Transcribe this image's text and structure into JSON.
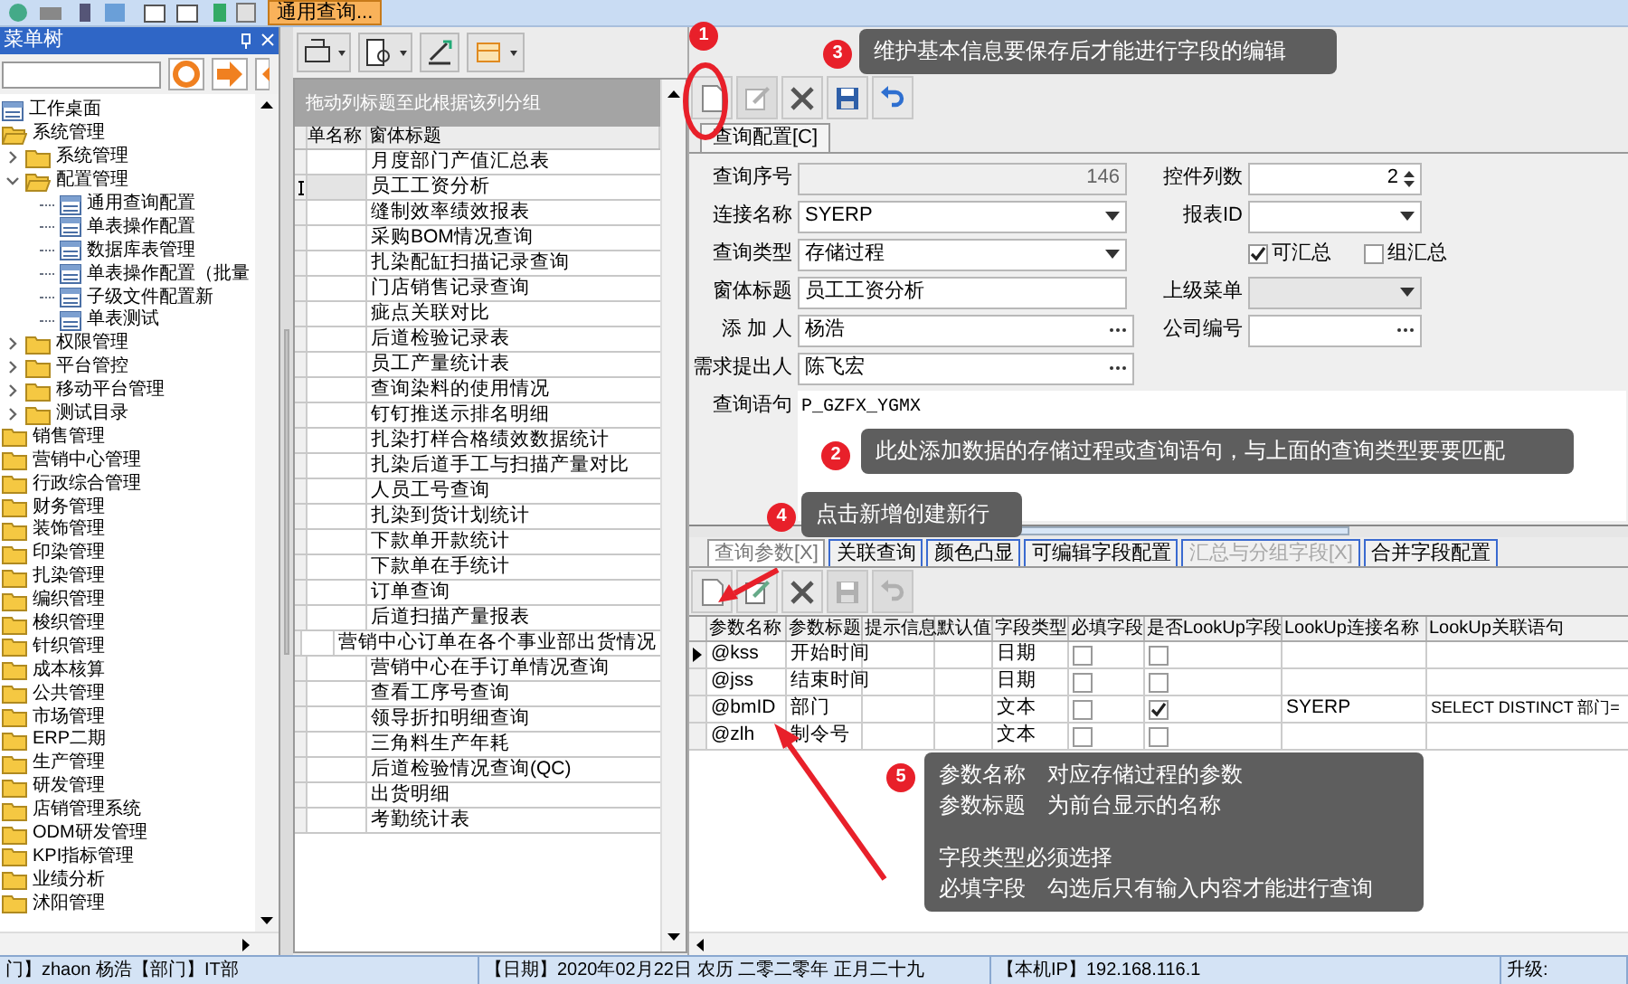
{
  "app_toolbar": {
    "button": "通用查询..."
  },
  "menu_tree": {
    "title": "菜单树",
    "items": [
      {
        "label": "工作桌面",
        "kind": "form"
      },
      {
        "label": "系统管理",
        "kind": "folder",
        "expanded": true,
        "children": [
          {
            "label": "系统管理",
            "kind": "folder",
            "expanded": false
          },
          {
            "label": "配置管理",
            "kind": "folder",
            "expanded": true,
            "children": [
              {
                "label": "通用查询配置",
                "kind": "form"
              },
              {
                "label": "单表操作配置",
                "kind": "form"
              },
              {
                "label": "数据库表管理",
                "kind": "form"
              },
              {
                "label": "单表操作配置（批量",
                "kind": "form"
              },
              {
                "label": "子级文件配置新",
                "kind": "form"
              },
              {
                "label": "单表测试",
                "kind": "form"
              }
            ]
          },
          {
            "label": "权限管理",
            "kind": "folder",
            "expanded": false
          },
          {
            "label": "平台管控",
            "kind": "folder",
            "expanded": false
          },
          {
            "label": "移动平台管理",
            "kind": "folder",
            "expanded": false
          },
          {
            "label": "测试目录",
            "kind": "folder",
            "expanded": false
          }
        ]
      },
      {
        "label": "销售管理",
        "kind": "folder"
      },
      {
        "label": "营销中心管理",
        "kind": "folder"
      },
      {
        "label": "行政综合管理",
        "kind": "folder"
      },
      {
        "label": "财务管理",
        "kind": "folder"
      },
      {
        "label": "装饰管理",
        "kind": "folder"
      },
      {
        "label": "印染管理",
        "kind": "folder"
      },
      {
        "label": "扎染管理",
        "kind": "folder"
      },
      {
        "label": "编织管理",
        "kind": "folder"
      },
      {
        "label": "梭织管理",
        "kind": "folder"
      },
      {
        "label": "针织管理",
        "kind": "folder"
      },
      {
        "label": "成本核算",
        "kind": "folder"
      },
      {
        "label": "公共管理",
        "kind": "folder"
      },
      {
        "label": "市场管理",
        "kind": "folder"
      },
      {
        "label": "ERP二期",
        "kind": "folder"
      },
      {
        "label": "生产管理",
        "kind": "folder"
      },
      {
        "label": "研发管理",
        "kind": "folder"
      },
      {
        "label": "店销管理系统",
        "kind": "folder"
      },
      {
        "label": "ODM研发管理",
        "kind": "folder"
      },
      {
        "label": "KPI指标管理",
        "kind": "folder"
      },
      {
        "label": "业绩分析",
        "kind": "folder"
      },
      {
        "label": "沭阳管理",
        "kind": "folder"
      }
    ]
  },
  "report_list": {
    "group_hint": "拖动列标题至此根据该列分组",
    "columns": [
      "单名称",
      "窗体标题"
    ],
    "rows": [
      {
        "title": "月度部门产值汇总表",
        "selected": false
      },
      {
        "title": "员工工资分析",
        "selected": true
      },
      {
        "title": "缝制效率绩效报表",
        "selected": false
      },
      {
        "title": "采购BOM情况查询",
        "selected": false
      },
      {
        "title": "扎染配缸扫描记录查询",
        "selected": false
      },
      {
        "title": "门店销售记录查询",
        "selected": false
      },
      {
        "title": "疵点关联对比",
        "selected": false
      },
      {
        "title": "后道检验记录表",
        "selected": false
      },
      {
        "title": "员工产量统计表",
        "selected": false
      },
      {
        "title": "查询染料的使用情况",
        "selected": false
      },
      {
        "title": "钉钉推送示排名明细",
        "selected": false
      },
      {
        "title": "扎染打样合格绩效数据统计",
        "selected": false
      },
      {
        "title": "扎染后道手工与扫描产量对比",
        "selected": false
      },
      {
        "title": "人员工号查询",
        "selected": false
      },
      {
        "title": "扎染到货计划统计",
        "selected": false
      },
      {
        "title": "下款单开款统计",
        "selected": false
      },
      {
        "title": "下款单在手统计",
        "selected": false
      },
      {
        "title": "订单查询",
        "selected": false
      },
      {
        "title": "后道扫描产量报表",
        "selected": false
      },
      {
        "title": "营销中心订单在各个事业部出货情况",
        "selected": false
      },
      {
        "title": "营销中心在手订单情况查询",
        "selected": false
      },
      {
        "title": "查看工序号查询",
        "selected": false
      },
      {
        "title": "领导折扣明细查询",
        "selected": false
      },
      {
        "title": "三角料生产年耗",
        "selected": false
      },
      {
        "title": "后道检验情况查询(QC)",
        "selected": false
      },
      {
        "title": "出货明细",
        "selected": false
      },
      {
        "title": "考勤统计表",
        "selected": false
      }
    ]
  },
  "form_toolbar": [
    {
      "kind": "new",
      "disabled": false
    },
    {
      "kind": "edit",
      "disabled": true
    },
    {
      "kind": "delete",
      "disabled": false
    },
    {
      "kind": "save",
      "disabled": false
    },
    {
      "kind": "undo",
      "disabled": false
    }
  ],
  "form_tab": "查询配置[C]",
  "form": {
    "left": [
      {
        "label": "查询序号",
        "kind": "readonly",
        "value": "146"
      },
      {
        "label": "连接名称",
        "kind": "select",
        "value": "SYERP",
        "disabled": false
      },
      {
        "label": "查询类型",
        "kind": "select",
        "value": "存储过程",
        "disabled": false
      },
      {
        "label": "窗体标题",
        "kind": "text",
        "value": "员工工资分析"
      },
      {
        "label": "添 加 人",
        "kind": "lookup",
        "value": "杨浩"
      },
      {
        "label": "需求提出人",
        "kind": "lookup",
        "value": "陈飞宏"
      }
    ],
    "right": [
      {
        "label": "控件列数",
        "kind": "spin",
        "value": "2"
      },
      {
        "label": "报表ID",
        "kind": "select",
        "disabled": false
      },
      {
        "kind": "checks",
        "options": [
          {
            "label": "可汇总",
            "checked": true
          },
          {
            "label": "组汇总",
            "checked": false
          }
        ]
      },
      {
        "label": "上级菜单",
        "kind": "select",
        "disabled": true
      },
      {
        "label": "公司编号",
        "kind": "lookup"
      }
    ],
    "query": {
      "label": "查询语句",
      "value": "P_GZFX_YGMX"
    }
  },
  "detail_tabs": [
    {
      "label": "查询参数[X]",
      "selected": true,
      "disabled": false
    },
    {
      "label": "关联查询",
      "selected": false,
      "disabled": false
    },
    {
      "label": "颜色凸显",
      "selected": false,
      "disabled": false
    },
    {
      "label": "可编辑字段配置",
      "selected": false,
      "disabled": false
    },
    {
      "label": "汇总与分组字段[X]",
      "selected": false,
      "disabled": true
    },
    {
      "label": "合并字段配置",
      "selected": false,
      "disabled": false
    }
  ],
  "detail_toolbar": [
    {
      "kind": "new",
      "disabled": false
    },
    {
      "kind": "edit",
      "disabled": false
    },
    {
      "kind": "delete",
      "disabled": false
    },
    {
      "kind": "save",
      "disabled": true
    },
    {
      "kind": "undo",
      "disabled": true
    }
  ],
  "params": {
    "columns": [
      "参数名称",
      "参数标题",
      "提示信息",
      "默认值",
      "字段类型",
      "必填字段",
      "是否LookUp字段",
      "LookUp连接名称",
      "LookUp关联语句"
    ],
    "rows": [
      {
        "name": "@kss",
        "title": "开始时间",
        "type": "日期",
        "required": false,
        "lookup": false,
        "selected": true
      },
      {
        "name": "@jss",
        "title": "结束时间",
        "type": "日期",
        "required": false,
        "lookup": false,
        "selected": false
      },
      {
        "name": "@bmID",
        "title": "部门",
        "type": "文本",
        "required": false,
        "lookup": true,
        "lookup_conn": "SYERP",
        "lookup_sql": "SELECT DISTINCT 部门=",
        "selected": false
      },
      {
        "name": "@zlh",
        "title": "制令号",
        "type": "文本",
        "required": false,
        "lookup": false,
        "selected": false
      }
    ]
  },
  "status_bar": [
    "门】zhaon 杨浩【部门】IT部",
    "【日期】2020年02月22日 农历 二零二零年 正月二十九",
    "【本机IP】192.168.116.1",
    "升级:"
  ],
  "annotations": [
    {
      "number": "1"
    },
    {
      "number": "3",
      "paragraphs": [
        [
          "维护基本信息要保存后才能进行字段的编辑"
        ]
      ]
    },
    {
      "number": "2",
      "paragraphs": [
        [
          "此处添加数据的存储过程或查询语句，与上面的查询类型要要匹配"
        ]
      ]
    },
    {
      "number": "4",
      "paragraphs": [
        [
          "点击新增创建新行"
        ]
      ]
    },
    {
      "number": "5",
      "paragraphs": [
        [
          "参数名称　对应存储过程的参数",
          "参数标题　为前台显示的名称"
        ],
        [
          "字段类型必须选择",
          "必填字段　勾选后只有输入内容才能进行查询"
        ]
      ]
    }
  ]
}
